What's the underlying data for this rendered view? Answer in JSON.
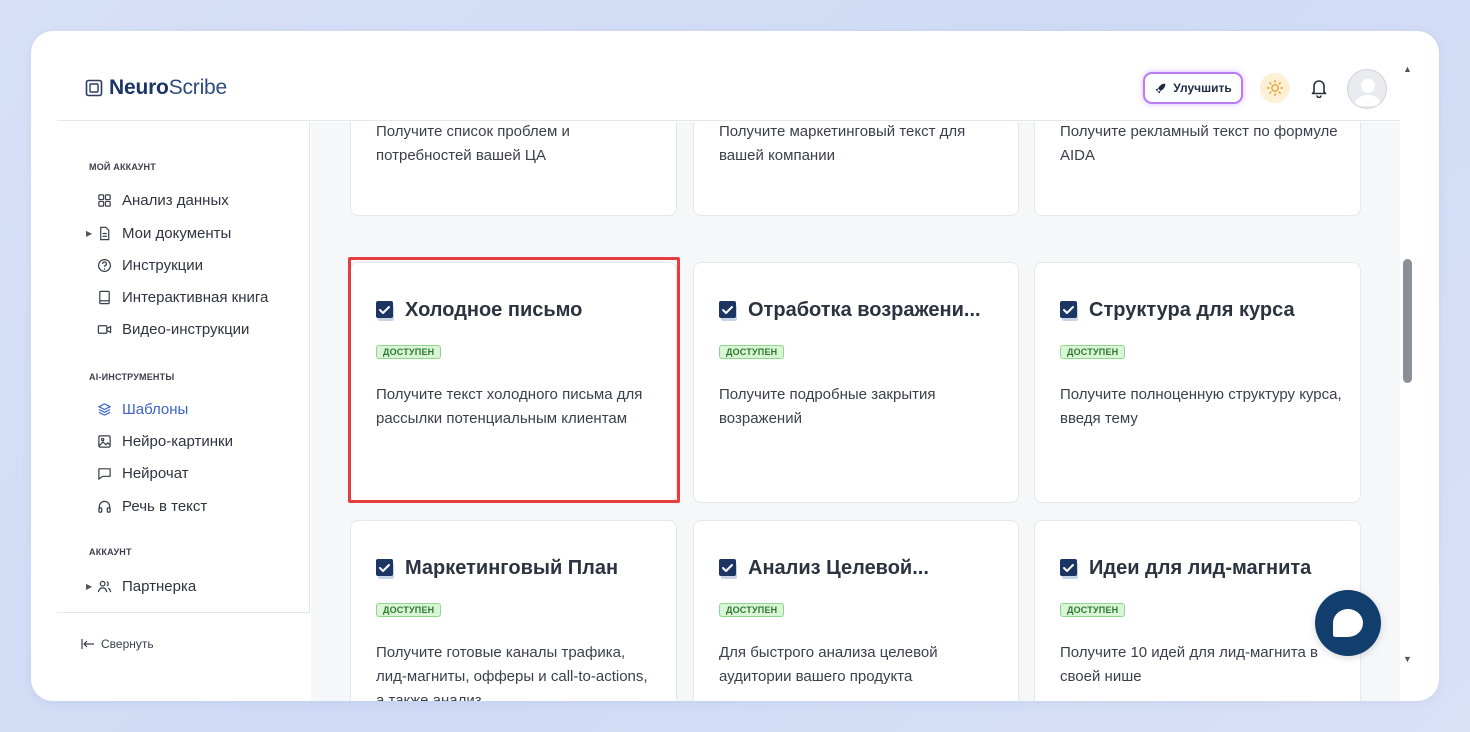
{
  "app": {
    "logo_bold": "Neuro",
    "logo_regular": "Scribe"
  },
  "header": {
    "upgrade_label": "Улучшить",
    "upgrade_border_color": "#b97cf2"
  },
  "sidebar": {
    "sections": [
      {
        "label": "МОЙ АККАУНТ"
      },
      {
        "label": "AI-ИНСТРУМЕНТЫ"
      },
      {
        "label": "АККАУНТ"
      }
    ],
    "items": [
      {
        "label": "Анализ данных",
        "icon": "grid-icon"
      },
      {
        "label": "Мои документы",
        "icon": "document-icon"
      },
      {
        "label": "Инструкции",
        "icon": "help-circle-icon"
      },
      {
        "label": "Интерактивная книга",
        "icon": "book-icon"
      },
      {
        "label": "Видео-инструкции",
        "icon": "video-icon"
      },
      {
        "label": "Шаблоны",
        "icon": "layers-icon",
        "active": true
      },
      {
        "label": "Нейро-картинки",
        "icon": "image-icon"
      },
      {
        "label": "Нейрочат",
        "icon": "chat-icon"
      },
      {
        "label": "Речь в текст",
        "icon": "headphones-icon"
      },
      {
        "label": "Партнерка",
        "icon": "users-icon"
      }
    ],
    "collapse_label": "Свернуть",
    "active_color": "#3b63c9"
  },
  "cards_top": [
    {
      "desc": "Получите список проблем и потребностей вашей ЦА"
    },
    {
      "desc": "Получите маркетинговый текст для вашей компании"
    },
    {
      "desc": "Получите рекламный текст по формуле AIDA"
    }
  ],
  "cards": [
    {
      "title": "Холодное письмо",
      "badge": "ДОСТУПЕН",
      "desc": "Получите текст холодного письма для рассылки потенциальным клиентам",
      "highlighted": true
    },
    {
      "title": "Отработка возражени...",
      "badge": "ДОСТУПЕН",
      "desc": "Получите подробные закрытия возражений"
    },
    {
      "title": "Структура для курса",
      "badge": "ДОСТУПЕН",
      "desc": "Получите полноценную структуру курса, введя тему"
    },
    {
      "title": "Маркетинговый План",
      "badge": "ДОСТУПЕН",
      "desc": "Получите готовые каналы трафика, лид-магниты, офферы и call-to-actions, а также анализ"
    },
    {
      "title": "Анализ Целевой...",
      "badge": "ДОСТУПЕН",
      "desc": "Для быстрого анализа целевой аудитории вашего продукта"
    },
    {
      "title": "Идеи для лид-магнита",
      "badge": "ДОСТУПЕН",
      "desc": "Получите 10 идей для лид-магнита в своей нише"
    }
  ],
  "colors": {
    "brand_dark": "#1c3563",
    "highlight_border": "#e43e3e",
    "badge_bg": "#d9f4d6",
    "chat_fab": "#123e6e"
  }
}
